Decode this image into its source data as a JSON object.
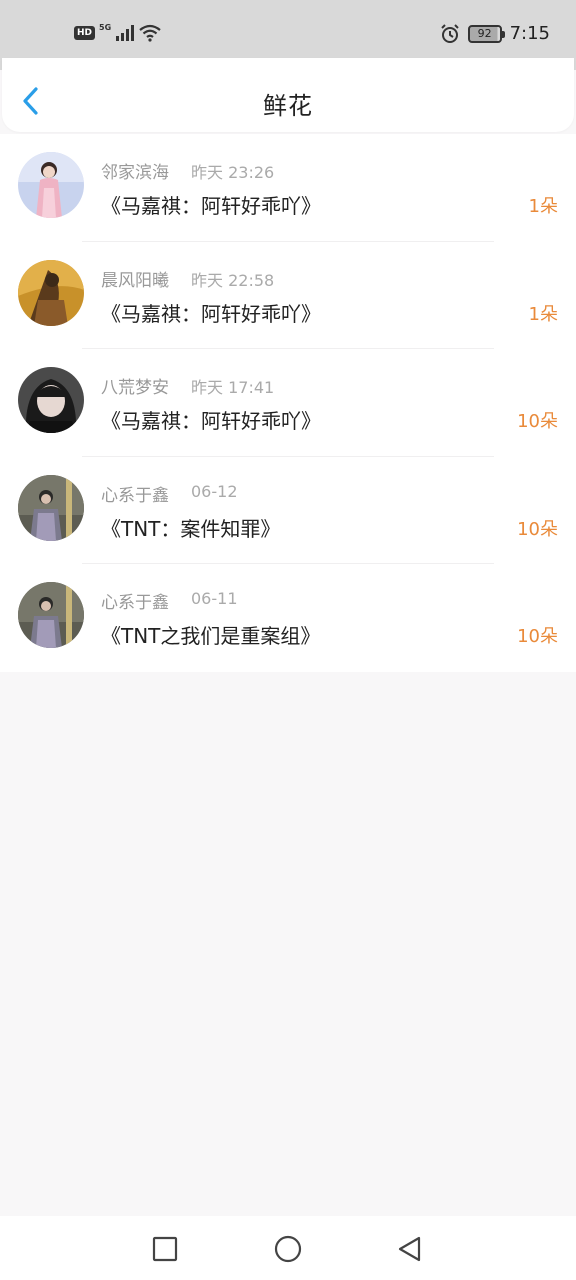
{
  "status_bar": {
    "hd": "HD",
    "network": "5G",
    "battery": "92",
    "time": "7:15",
    "icons": [
      "hd-icon",
      "signal-icon",
      "wifi-icon",
      "alarm-icon",
      "battery-icon"
    ]
  },
  "header": {
    "title": "鲜花",
    "back_icon": "chevron-left-icon",
    "accent": "#2a9ee8"
  },
  "records": [
    {
      "name": "邻家滨海",
      "time": "昨天 23:26",
      "book": "《马嘉祺：阿轩好乖吖》",
      "amount": "1朵",
      "avatar_color": "#b9c6e6"
    },
    {
      "name": "晨风阳曦",
      "time": "昨天 22:58",
      "book": "《马嘉祺：阿轩好乖吖》",
      "amount": "1朵",
      "avatar_color": "#c8912a"
    },
    {
      "name": "八荒梦安",
      "time": "昨天 17:41",
      "book": "《马嘉祺：阿轩好乖吖》",
      "amount": "10朵",
      "avatar_color": "#3a3a3a"
    },
    {
      "name": "心系于鑫",
      "time": "06-12",
      "book": "《TNT：案件知罪》",
      "amount": "10朵",
      "avatar_color": "#6a6a60"
    },
    {
      "name": "心系于鑫",
      "time": "06-11",
      "book": "《TNT之我们是重案组》",
      "amount": "10朵",
      "avatar_color": "#6a6a60"
    }
  ],
  "colors": {
    "amount": "#e98a3a",
    "background": "#f8f7f8"
  },
  "navigation_bar": {
    "icons": [
      "square-icon",
      "circle-icon",
      "triangle-back-icon"
    ]
  }
}
